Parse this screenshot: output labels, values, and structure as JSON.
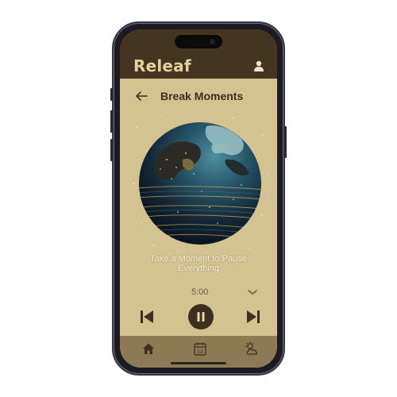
{
  "app": {
    "name": "Releaf"
  },
  "header": {
    "profile_icon": "user-icon"
  },
  "page": {
    "title": "Break Moments",
    "back_icon": "arrow-left-icon"
  },
  "track": {
    "caption_line1": "Take a Moment to Pause",
    "caption_line2": "Everything",
    "duration": "5:00",
    "artwork": "globe-artwork"
  },
  "player": {
    "prev_icon": "skip-previous-icon",
    "pause_icon": "pause-icon",
    "next_icon": "skip-next-icon",
    "options_icon": "chevron-down-icon"
  },
  "tabs": [
    {
      "icon": "home-icon"
    },
    {
      "icon": "calendar-icon",
      "day": "12"
    },
    {
      "icon": "weather-icon"
    }
  ],
  "colors": {
    "background": "#d3c391",
    "header": "#43351f",
    "brand_text": "#e3d2a3",
    "accent_dark": "#3e3020",
    "tabbar": "#8c7a55"
  }
}
